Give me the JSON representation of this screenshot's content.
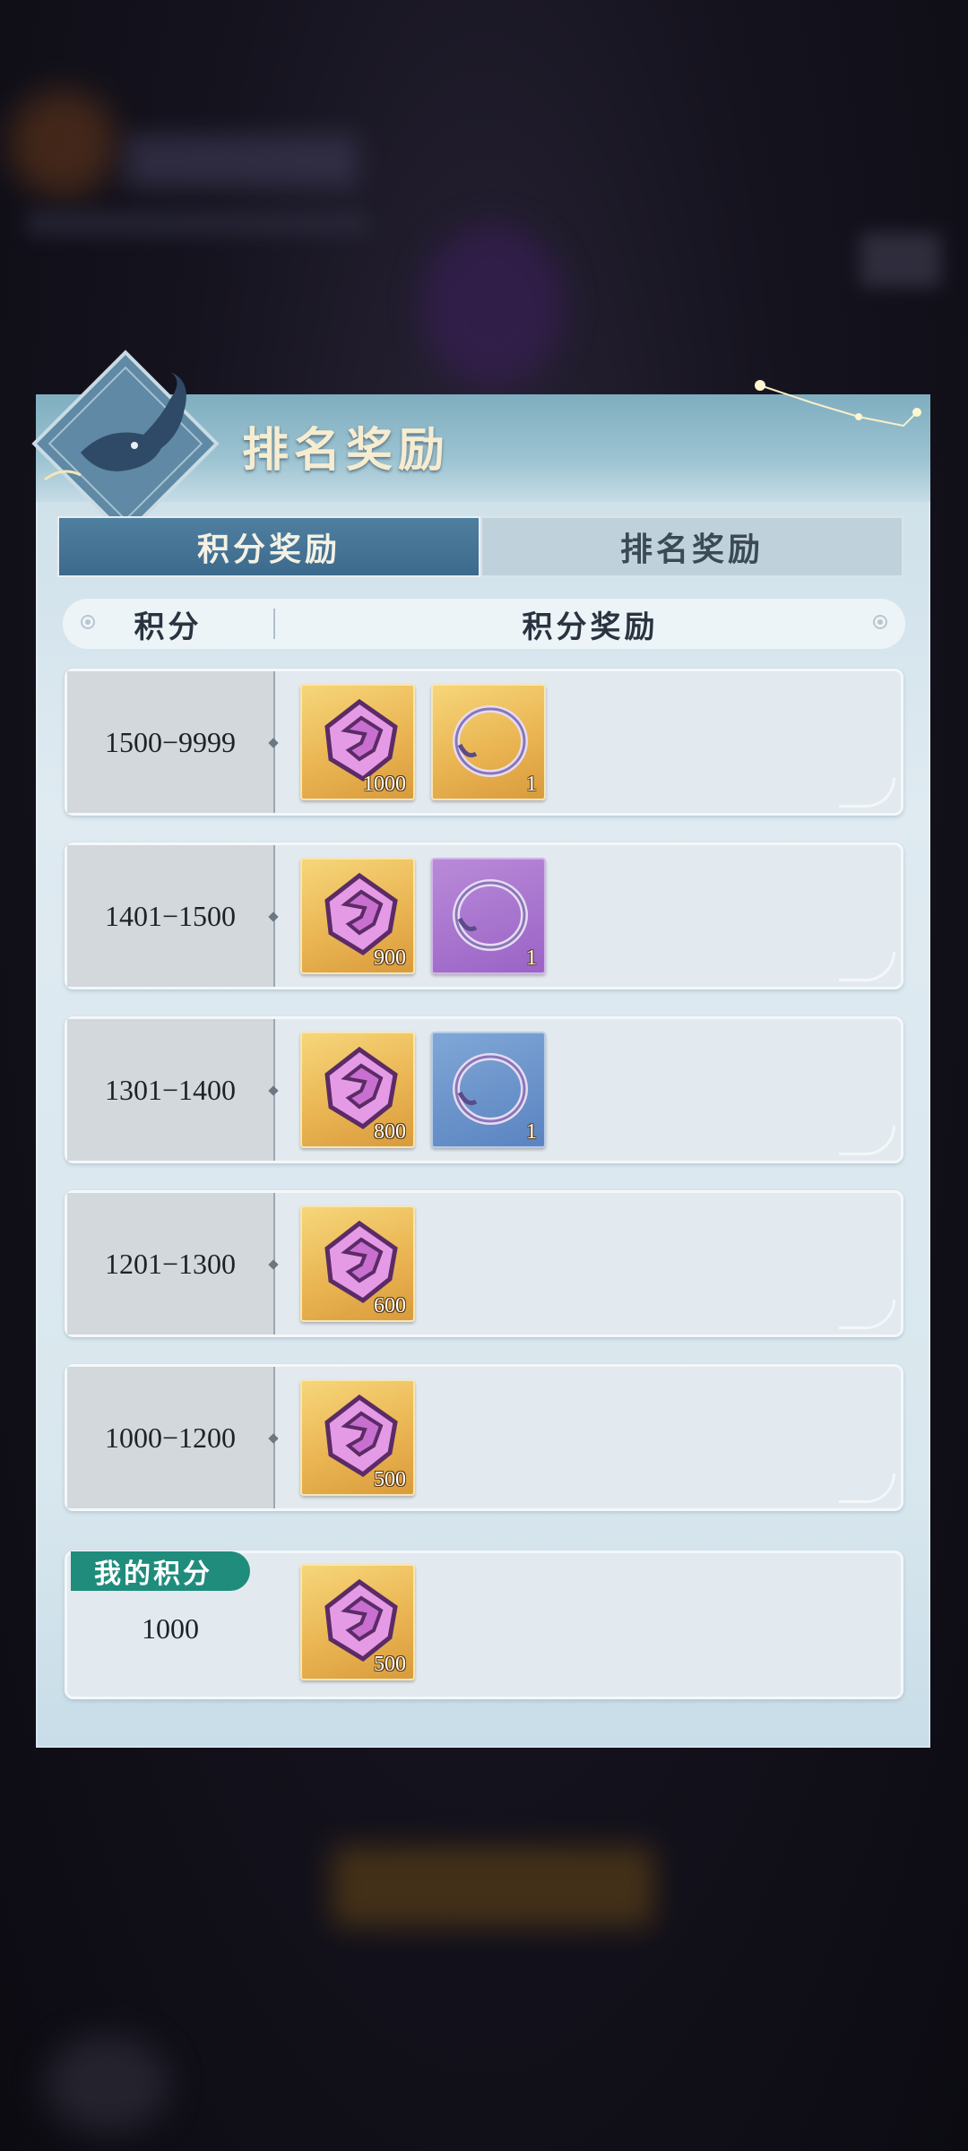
{
  "panel": {
    "title": "排名奖励"
  },
  "tabs": [
    {
      "label": "积分奖励",
      "active": true
    },
    {
      "label": "排名奖励",
      "active": false
    }
  ],
  "columns": {
    "score": "积分",
    "reward": "积分奖励"
  },
  "rows": [
    {
      "range": "1500−9999",
      "items": [
        {
          "type": "pink-token",
          "bg": "gold",
          "qty": "1000"
        },
        {
          "type": "ring",
          "bg": "gold",
          "qty": "1"
        }
      ]
    },
    {
      "range": "1401−1500",
      "items": [
        {
          "type": "pink-token",
          "bg": "gold",
          "qty": "900"
        },
        {
          "type": "ring",
          "bg": "purple",
          "qty": "1"
        }
      ]
    },
    {
      "range": "1301−1400",
      "items": [
        {
          "type": "pink-token",
          "bg": "gold",
          "qty": "800"
        },
        {
          "type": "ring",
          "bg": "blue",
          "qty": "1"
        }
      ]
    },
    {
      "range": "1201−1300",
      "items": [
        {
          "type": "pink-token",
          "bg": "gold",
          "qty": "600"
        }
      ]
    },
    {
      "range": "1000−1200",
      "items": [
        {
          "type": "pink-token",
          "bg": "gold",
          "qty": "500"
        }
      ]
    }
  ],
  "my_score": {
    "label": "我的积分",
    "value": "1000",
    "item": {
      "type": "pink-token",
      "bg": "gold",
      "qty": "500"
    }
  },
  "colors": {
    "tab_active": "#3c6a8c",
    "my_label": "#1f8c7c",
    "title": "#f6ecd0"
  }
}
